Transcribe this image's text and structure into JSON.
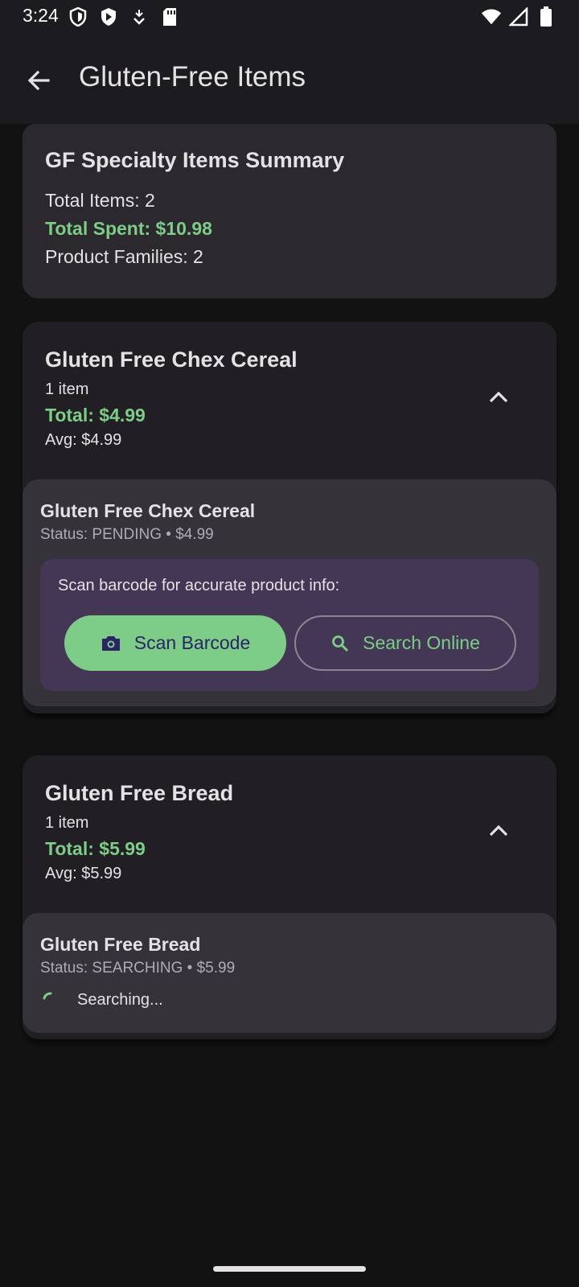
{
  "status_bar": {
    "time": "3:24",
    "icons_left": [
      "shield-icon",
      "play-icon",
      "download-icon",
      "sd-card-icon"
    ],
    "icons_right": [
      "wifi-icon",
      "signal-icon",
      "battery-icon"
    ]
  },
  "app_bar": {
    "title": "Gluten-Free Items",
    "back_icon": "arrow-back-icon"
  },
  "summary": {
    "title": "GF Specialty Items Summary",
    "total_items": "Total Items: 2",
    "total_spent": "Total Spent: $10.98",
    "product_families": "Product Families: 2"
  },
  "groups": [
    {
      "title": "Gluten Free Chex Cereal",
      "count": "1 item",
      "total": "Total: $4.99",
      "avg": "Avg: $4.99",
      "item": {
        "name": "Gluten Free Chex Cereal",
        "status": "Status: PENDING • $4.99",
        "scan_prompt": "Scan barcode for accurate product info:",
        "scan_button": "Scan Barcode",
        "search_button": "Search Online"
      }
    },
    {
      "title": "Gluten Free Bread",
      "count": "1 item",
      "total": "Total: $5.99",
      "avg": "Avg: $5.99",
      "item": {
        "name": "Gluten Free Bread",
        "status": "Status: SEARCHING • $5.99",
        "searching_text": "Searching..."
      }
    }
  ],
  "colors": {
    "accent_green": "#7dcc87",
    "scan_box_bg": "#433755",
    "scan_button_text": "#2a2466",
    "background": "#121212"
  }
}
